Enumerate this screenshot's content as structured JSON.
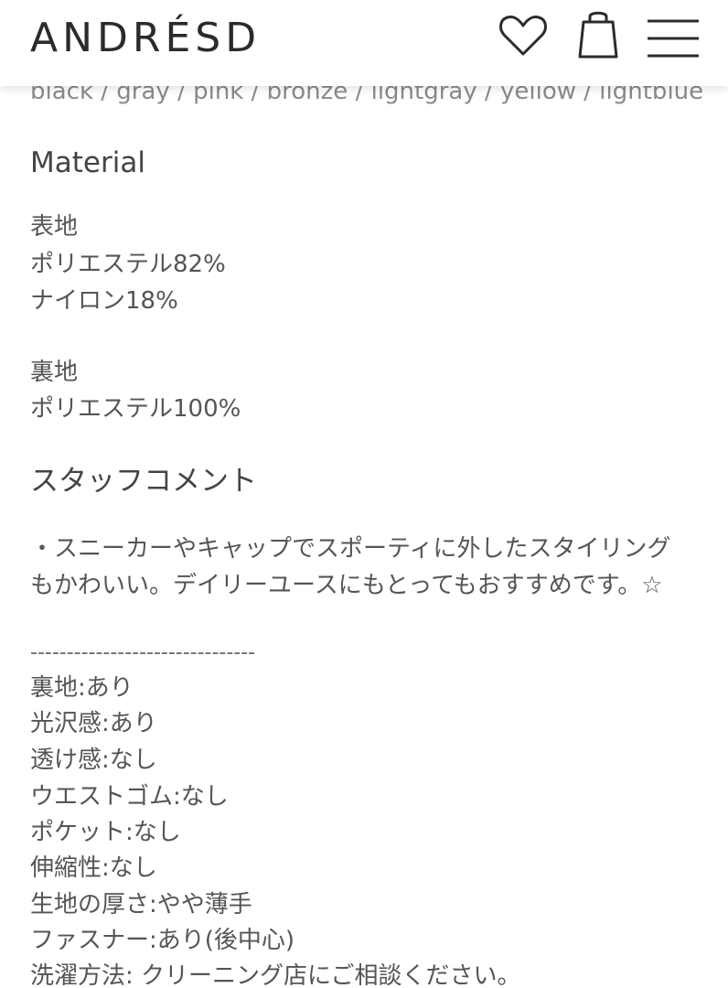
{
  "header": {
    "logo": "ANDRÉSD",
    "icons": [
      "heart-icon",
      "shopping-bag-icon",
      "menu-icon"
    ]
  },
  "colors_line": "black / gray / pink / bronze / lightgray / yellow / lightblue",
  "material": {
    "heading": "Material",
    "outer_label": "表地",
    "outer_line1": "ポリエステル82%",
    "outer_line2": "ナイロン18%",
    "lining_label": "裏地",
    "lining_line1": "ポリエステル100%"
  },
  "staff": {
    "heading": "スタッフコメント",
    "comment_line1": "・スニーカーやキャップでスポーティに外したスタイリング",
    "comment_line2": "もかわいい。デイリーユースにもとってもおすすめです。☆",
    "divider": "-------------------------------",
    "specs": [
      "裏地:あり",
      "光沢感:あり",
      "透け感:なし",
      "ウエストゴム:なし",
      "ポケット:なし",
      "伸縮性:なし",
      "生地の厚さ:やや薄手",
      "ファスナー:あり(後中心)",
      "洗濯方法: クリーニング店にご相談ください。"
    ]
  }
}
